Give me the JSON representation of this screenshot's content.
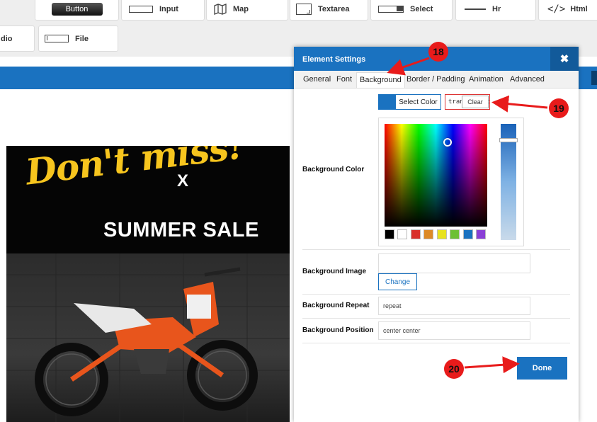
{
  "toolbar": {
    "items": [
      {
        "label": "Button"
      },
      {
        "label": "Input"
      },
      {
        "label": "Map"
      },
      {
        "label": "Textarea"
      },
      {
        "label": "Select"
      },
      {
        "label": "Hr"
      },
      {
        "label": "Html",
        "icon_text": "</>"
      },
      {
        "label": "dio"
      },
      {
        "label": "File"
      }
    ]
  },
  "banner": {
    "script_text": "Don't miss!",
    "headline": "SUMMER SALE",
    "close_glyph": "X"
  },
  "dialog": {
    "title": "Element Settings",
    "close_glyph": "✖",
    "tabs": [
      {
        "label": "General"
      },
      {
        "label": "Font"
      },
      {
        "label": "Background",
        "active": true
      },
      {
        "label": "Border / Padding"
      },
      {
        "label": "Animation"
      },
      {
        "label": "Advanced"
      }
    ],
    "background_color": {
      "label": "Background Color",
      "select_label": "Select Color",
      "value": "transparent",
      "clear_label": "Clear",
      "swatch_color": "#1a72c0",
      "palette": [
        "#000000",
        "#ffffff",
        "#d9302b",
        "#dd8a26",
        "#e8e21e",
        "#6dc034",
        "#1a72c0",
        "#8a3fd6"
      ]
    },
    "background_image": {
      "label": "Background Image",
      "value": "",
      "change_label": "Change"
    },
    "background_repeat": {
      "label": "Background Repeat",
      "value": "repeat"
    },
    "background_position": {
      "label": "Background Position",
      "value": "center center"
    },
    "done_label": "Done"
  },
  "annotations": {
    "markers": [
      "18",
      "19",
      "20"
    ],
    "color": "#e81b1b"
  }
}
